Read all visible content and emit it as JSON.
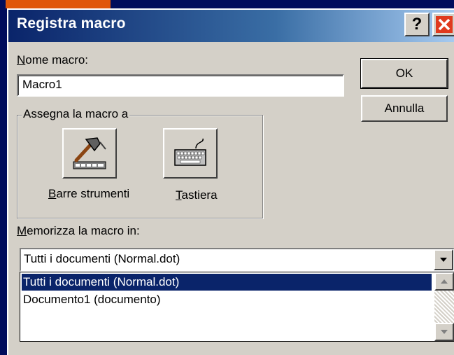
{
  "window": {
    "title": "Registra macro",
    "help_glyph": "?"
  },
  "macro_name": {
    "label_underlined": "N",
    "label_rest": "ome macro:",
    "value": "Macro1"
  },
  "buttons": {
    "ok": "OK",
    "cancel": "Annulla"
  },
  "assign_group": {
    "legend": "Assegna la macro a",
    "toolbars_u": "B",
    "toolbars_rest": "arre strumenti",
    "keyboard_u": "T",
    "keyboard_rest": "astiera"
  },
  "store_in": {
    "label_underlined": "M",
    "label_rest": "emorizza la macro in:",
    "selected": "Tutti i documenti (Normal.dot)",
    "options": [
      "Tutti i documenti (Normal.dot)",
      "Documento1 (documento)"
    ]
  },
  "colors": {
    "selection": "#0a246a",
    "dialog_face": "#d4d0c8",
    "close_red": "#e03a1e"
  },
  "icons": [
    "help-icon",
    "close-icon",
    "hammer-toolbar-icon",
    "keyboard-icon",
    "dropdown-arrow-icon",
    "scroll-up-icon",
    "scroll-down-icon"
  ]
}
